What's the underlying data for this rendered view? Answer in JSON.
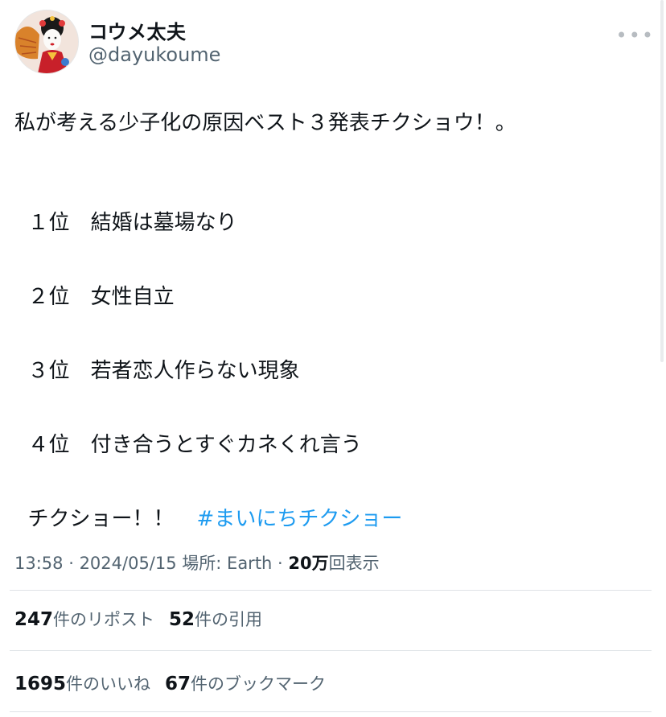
{
  "author": {
    "display_name": "コウメ太夫",
    "handle": "@dayukoume",
    "more_icon": "more-horizontal-icon"
  },
  "tweet": {
    "intro": "私が考える少子化の原因ベスト３発表チクショウ！。",
    "rankings": [
      {
        "rank": "１位",
        "text": "結婚は墓場なり"
      },
      {
        "rank": "２位",
        "text": "女性自立"
      },
      {
        "rank": "３位",
        "text": "若者恋人作らない現象"
      },
      {
        "rank": "４位",
        "text": "付き合うとすぐカネくれ言う"
      }
    ],
    "closing": "チクショー！！",
    "hashtag": "#まいにちチクショー"
  },
  "meta": {
    "time": "13:58",
    "date": "2024/05/15",
    "location_label": "場所: Earth",
    "views_count": "20万",
    "views_label": "回表示"
  },
  "stats": {
    "reposts_count": "247",
    "reposts_label": "件のリポスト",
    "quotes_count": "52",
    "quotes_label": "件の引用",
    "likes_count": "1695",
    "likes_label": "件のいいね",
    "bookmarks_count": "67",
    "bookmarks_label": "件のブックマーク"
  }
}
